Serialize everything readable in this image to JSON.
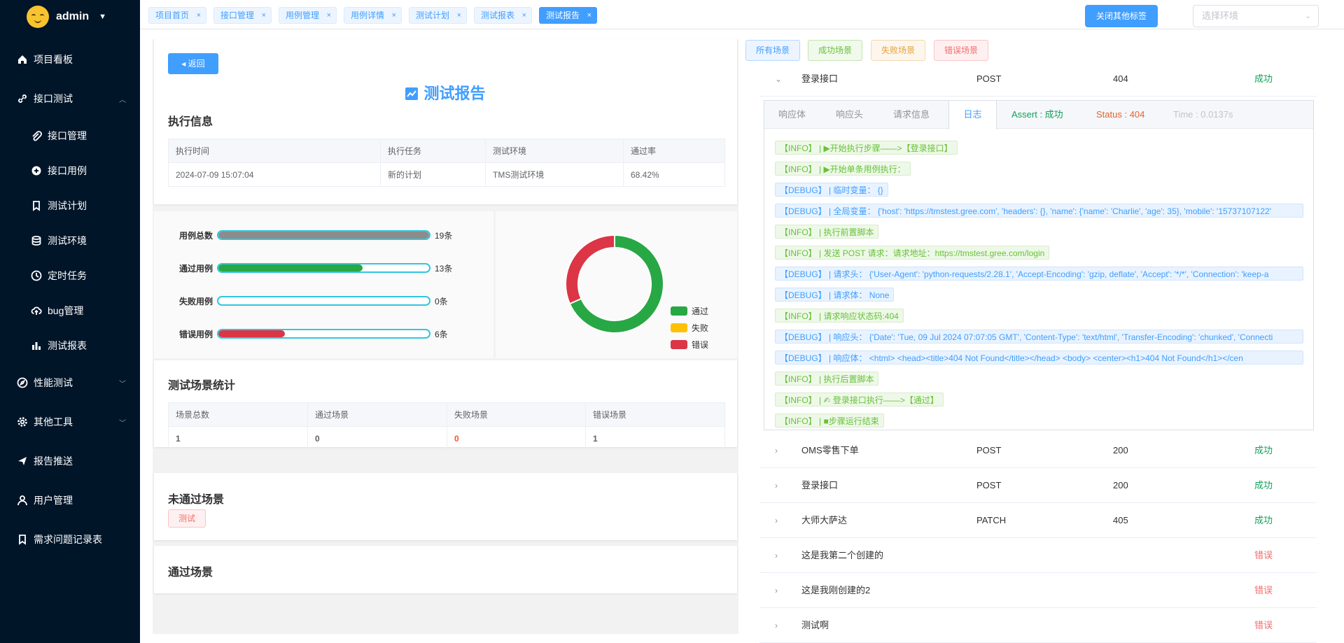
{
  "sidebar": {
    "username": "admin",
    "items": [
      {
        "label": "项目看板",
        "icon": "home-icon",
        "type": "top"
      },
      {
        "label": "接口测试",
        "icon": "link-icon",
        "type": "top",
        "arrow": "up-icon"
      },
      {
        "label": "接口管理",
        "icon": "paperclip-icon",
        "type": "sub"
      },
      {
        "label": "接口用例",
        "icon": "plus-circle-icon",
        "type": "sub"
      },
      {
        "label": "测试计划",
        "icon": "bookmark-icon",
        "type": "sub"
      },
      {
        "label": "测试环境",
        "icon": "database-icon",
        "type": "sub"
      },
      {
        "label": "定时任务",
        "icon": "clock-icon",
        "type": "sub"
      },
      {
        "label": "bug管理",
        "icon": "cloud-upload-icon",
        "type": "sub"
      },
      {
        "label": "测试报表",
        "icon": "bar-chart-icon",
        "type": "sub"
      },
      {
        "label": "性能测试",
        "icon": "compass-icon",
        "type": "top",
        "arrow": "down-icon"
      },
      {
        "label": "其他工具",
        "icon": "gear-icon",
        "type": "top",
        "arrow": "down-icon"
      },
      {
        "label": "报告推送",
        "icon": "send-icon",
        "type": "top"
      },
      {
        "label": "用户管理",
        "icon": "user-icon",
        "type": "top"
      },
      {
        "label": "需求问题记录表",
        "icon": "bookmark-icon",
        "type": "top"
      }
    ]
  },
  "tabs": [
    "项目首页",
    "接口管理",
    "用例管理",
    "用例详情",
    "测试计划",
    "测试报表",
    "测试报告"
  ],
  "active_tab": "测试报告",
  "close_other_tabs_label": "关闭其他标签",
  "env_placeholder": "选择环境",
  "report": {
    "back_label": "返回",
    "title": "测试报告",
    "exec_section": "执行信息",
    "exec_headers": [
      "执行时间",
      "执行任务",
      "测试环境",
      "通过率"
    ],
    "exec_values": [
      "2024-07-09 15:07:04",
      "新的计划",
      "TMS测试环境",
      "68.42%"
    ],
    "stats": [
      {
        "label": "用例总数",
        "count": "19条",
        "fraction": 1.0,
        "color": "#8c8c8c"
      },
      {
        "label": "通过用例",
        "count": "13条",
        "fraction": 0.684,
        "color": "#28a745"
      },
      {
        "label": "失败用例",
        "count": "0条",
        "fraction": 0.0,
        "color": "#ffc107"
      },
      {
        "label": "错误用例",
        "count": "6条",
        "fraction": 0.316,
        "color": "#dc3545"
      }
    ],
    "pie": {
      "slices": [
        {
          "name": "通过",
          "value": 13,
          "color": "#28a745"
        },
        {
          "name": "失败",
          "value": 0,
          "color": "#ffc107"
        },
        {
          "name": "错误",
          "value": 6,
          "color": "#dc3545"
        }
      ]
    },
    "scene_section": "测试场景统计",
    "scene_headers": [
      "场景总数",
      "通过场景",
      "失败场景",
      "错误场景"
    ],
    "scene_values": [
      "1",
      "0",
      "0",
      "1"
    ],
    "failed_section": "未通过场景",
    "failed_tag": "测试",
    "passed_section": "通过场景"
  },
  "filters": [
    {
      "label": "所有场景",
      "color": "#409eff",
      "bg": "#ecf5ff",
      "border": "#b3d8ff"
    },
    {
      "label": "成功场景",
      "color": "#67c23a",
      "bg": "#f0f9eb",
      "border": "#c2e7b0"
    },
    {
      "label": "失败场景",
      "color": "#e6a23c",
      "bg": "#fdf6ec",
      "border": "#f5dab1"
    },
    {
      "label": "错误场景",
      "color": "#f56c6c",
      "bg": "#fef0f0",
      "border": "#fbc4c4"
    }
  ],
  "steps_top": {
    "name": "登录接口",
    "method": "POST",
    "code": "404",
    "status": "成功",
    "status_type": "ok"
  },
  "log_tabs": [
    {
      "label": "响应体",
      "color": "#909399"
    },
    {
      "label": "响应头",
      "color": "#909399"
    },
    {
      "label": "请求信息",
      "color": "#909399"
    },
    {
      "label": "日志",
      "color": "#409eff"
    },
    {
      "label": "Assert : 成功",
      "color": "#13a05a"
    },
    {
      "label": "Status : 404",
      "color": "#e6622c"
    },
    {
      "label": "Time : 0.0137s",
      "color": "#c0c4cc"
    }
  ],
  "log_lines": [
    {
      "level": "info",
      "text": "【INFO】 | ▶开始执行步骤——>【登录接口】"
    },
    {
      "level": "info",
      "text": "【INFO】 | ▶开始单条用例执行："
    },
    {
      "level": "debug",
      "text": "【DEBUG】 | 临时变量： {}"
    },
    {
      "level": "debug",
      "text": "【DEBUG】 | 全局变量： {'host': 'https://tmstest.gree.com', 'headers': {}, 'name': {'name': 'Charlie', 'age': 35}, 'mobile': '15737107122'",
      "full": true
    },
    {
      "level": "info",
      "text": "【INFO】 | 执行前置脚本"
    },
    {
      "level": "info",
      "text": "【INFO】 | 发送 POST 请求：请求地址：https://tmstest.gree.com/login"
    },
    {
      "level": "debug",
      "text": "【DEBUG】 | 请求头： {'User-Agent': 'python-requests/2.28.1', 'Accept-Encoding': 'gzip, deflate', 'Accept': '*/*', 'Connection': 'keep-a",
      "full": true
    },
    {
      "level": "debug",
      "text": "【DEBUG】 | 请求体： None"
    },
    {
      "level": "info",
      "text": "【INFO】 | 请求响应状态码:404"
    },
    {
      "level": "debug",
      "text": "【DEBUG】 | 响应头： {'Date': 'Tue, 09 Jul 2024 07:07:05 GMT', 'Content-Type': 'text/html', 'Transfer-Encoding': 'chunked', 'Connecti",
      "full": true
    },
    {
      "level": "debug",
      "text": "【DEBUG】 | 响应体： <html> <head><title>404 Not Found</title></head> <body> <center><h1>404 Not Found</h1></cen",
      "full": true
    },
    {
      "level": "info",
      "text": "【INFO】 | 执行后置脚本"
    },
    {
      "level": "info",
      "text": "【INFO】 | ✍ 登录接口执行——>【通过】"
    },
    {
      "level": "info",
      "text": "【INFO】 | ■步骤运行结束"
    }
  ],
  "steps": [
    {
      "name": "OMS零售下单",
      "method": "POST",
      "code": "200",
      "status": "成功",
      "status_type": "ok"
    },
    {
      "name": "登录接口",
      "method": "POST",
      "code": "200",
      "status": "成功",
      "status_type": "ok"
    },
    {
      "name": "大师大萨达",
      "method": "PATCH",
      "code": "405",
      "status": "成功",
      "status_type": "ok"
    },
    {
      "name": "这是我第二个创建的",
      "method": "",
      "code": "",
      "status": "错误",
      "status_type": "err"
    },
    {
      "name": "这是我刚创建的2",
      "method": "",
      "code": "",
      "status": "错误",
      "status_type": "err"
    },
    {
      "name": "测试啊",
      "method": "",
      "code": "",
      "status": "错误",
      "status_type": "err"
    }
  ]
}
